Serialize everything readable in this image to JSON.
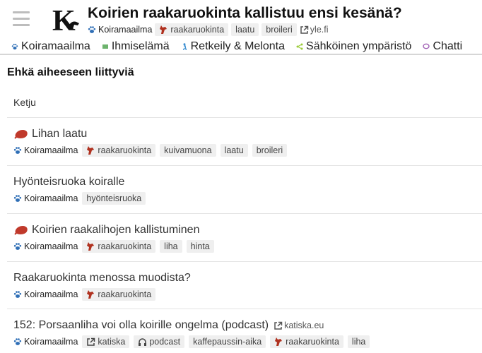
{
  "header": {
    "title": "Koirien raakaruokinta kallistuu ensi kesänä?",
    "category": "Koiramaailma",
    "tags": [
      "raakaruokinta",
      "laatu",
      "broileri"
    ],
    "source_link": "yle.fi"
  },
  "nav": [
    {
      "label": "Koiramaailma",
      "icon": "paw-icon",
      "color": "#2f6fb6"
    },
    {
      "label": "Ihmiselämä",
      "icon": "square-icon",
      "color": "#6db36d"
    },
    {
      "label": "Retkeily & Melonta",
      "icon": "hiker-icon",
      "color": "#3b8ed1"
    },
    {
      "label": "Sähköinen ympäristö",
      "icon": "network-icon",
      "color": "#9ccc3a"
    },
    {
      "label": "Chatti",
      "icon": "chat-icon",
      "color": "#a05fb5"
    }
  ],
  "related": {
    "heading": "Ehkä aiheeseen liittyviä",
    "column_header": "Ketju",
    "topics": [
      {
        "title": "Lihan laatu",
        "category": "Koiramaailma",
        "tags": [
          "raakaruokinta",
          "kuivamuona",
          "laatu",
          "broileri"
        ]
      },
      {
        "title": "Hyönteisruoka koiralle",
        "category": "Koiramaailma",
        "tags": [
          "hyönteisruoka"
        ]
      },
      {
        "title": "Koirien raakalihojen kallistuminen",
        "category": "Koiramaailma",
        "tags": [
          "raakaruokinta",
          "liha",
          "hinta"
        ]
      },
      {
        "title": "Raakaruokinta menossa muodista?",
        "category": "Koiramaailma",
        "tags": [
          "raakaruokinta"
        ]
      },
      {
        "title": "152: Porsaanliha voi olla koirille ongelma (podcast)",
        "link": "katiska.eu",
        "category": "Koiramaailma",
        "tags": [
          "katiska",
          "podcast",
          "kaffepaussin-aika",
          "raakaruokinta",
          "liha"
        ]
      }
    ]
  },
  "colors": {
    "accent_paw": "#2f6fb6",
    "meat": "#c0392b",
    "wolf": "#b0311f",
    "tag_bg": "#efefef"
  }
}
